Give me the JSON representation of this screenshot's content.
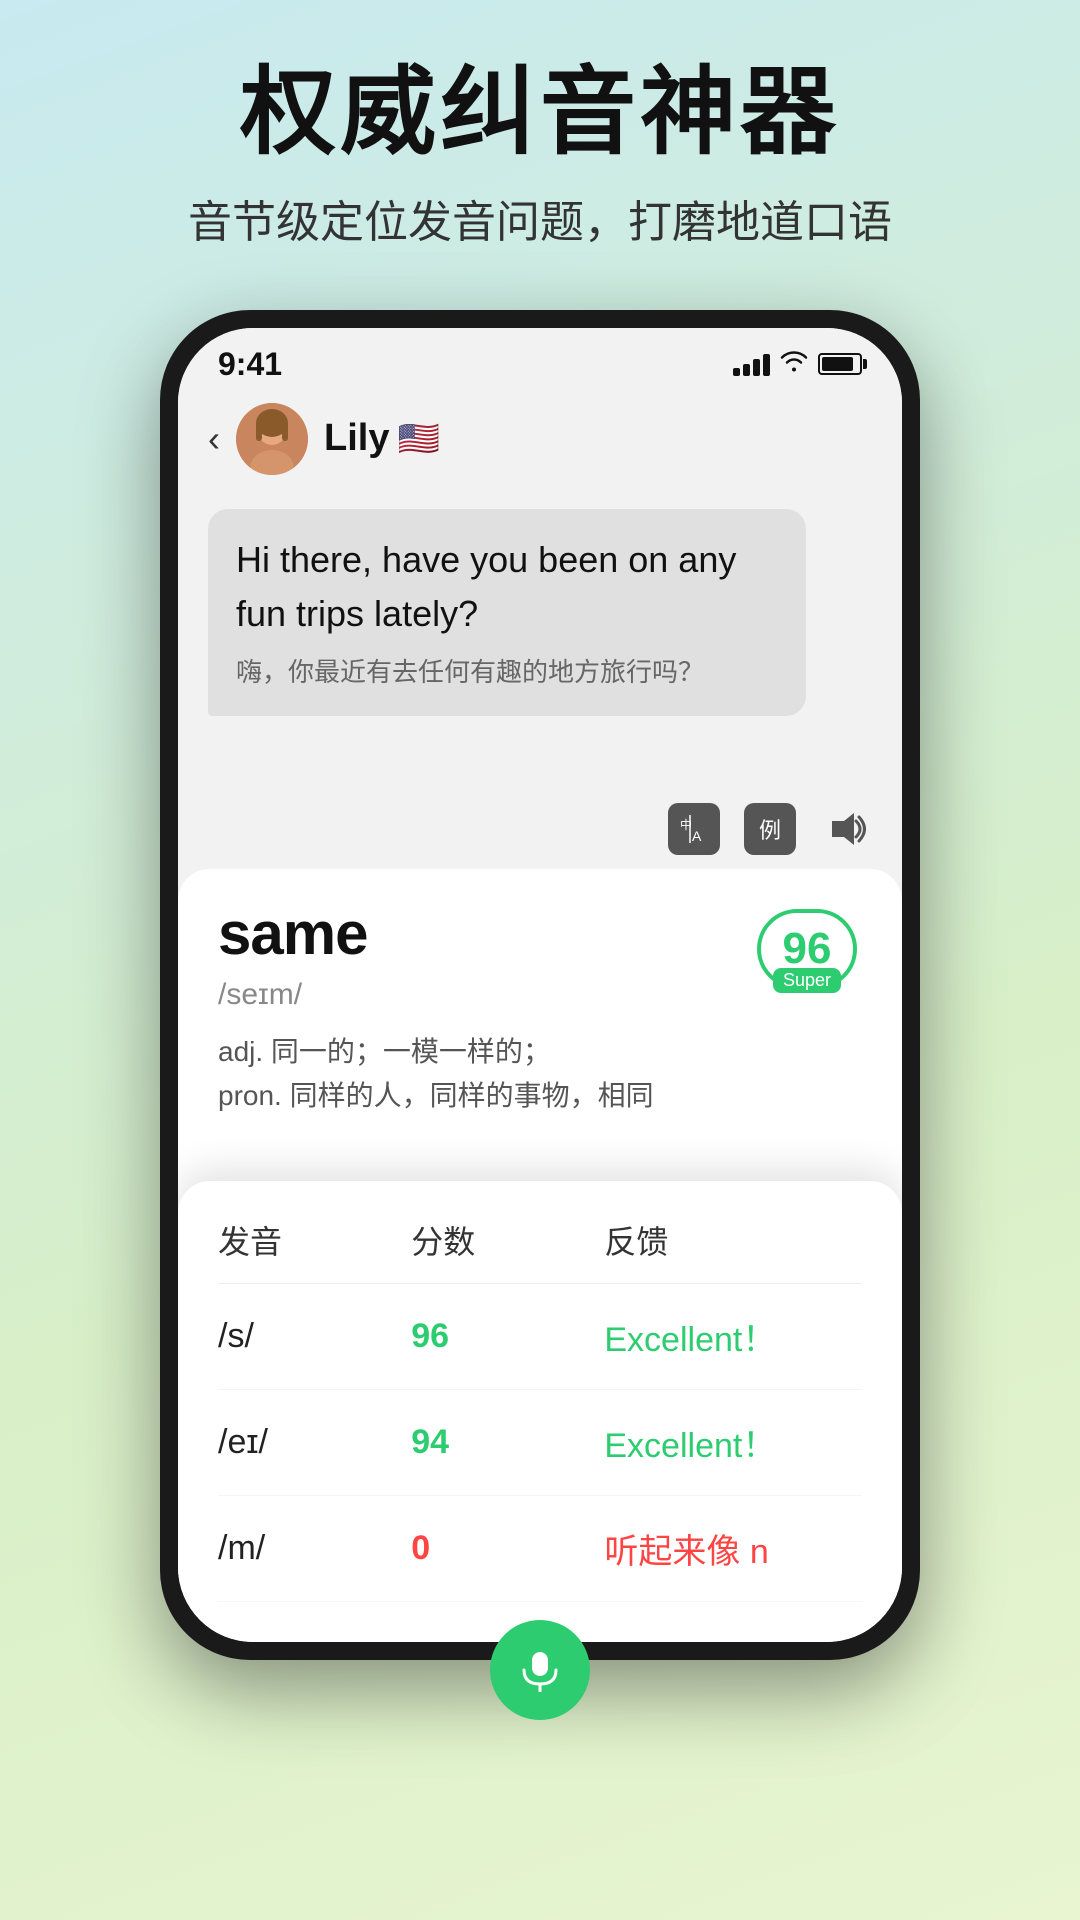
{
  "page": {
    "background": "linear-gradient(160deg, #c8eaf0 0%, #d8efc8 60%, #e8f5d0 100%)"
  },
  "header": {
    "main_title": "权威纠音神器",
    "sub_title": "音节级定位发音问题，打磨地道口语"
  },
  "phone": {
    "status_bar": {
      "time": "9:41"
    },
    "nav": {
      "back_label": "‹",
      "name": "Lily",
      "flag": "🇺🇸"
    },
    "chat": {
      "english_text": "Hi there, have you been on any fun trips lately?",
      "chinese_text": "嗨，你最近有去任何有趣的地方旅行吗？"
    },
    "action_buttons": {
      "translate": "中A",
      "example": "例",
      "sound": "🔊"
    },
    "word_card": {
      "word": "same",
      "phonetic": "/seɪm/",
      "score": "96",
      "score_label": "Super",
      "definition_1": "adj. 同一的；一模一样的；",
      "definition_2": "pron. 同样的人，同样的事物，相同"
    },
    "pron_table": {
      "headers": {
        "sound": "发音",
        "score": "分数",
        "feedback": "反馈"
      },
      "rows": [
        {
          "sound": "/s/",
          "score": "96",
          "score_color": "green",
          "feedback": "Excellent！",
          "feedback_color": "green"
        },
        {
          "sound": "/eɪ/",
          "score": "94",
          "score_color": "green",
          "feedback": "Excellent！",
          "feedback_color": "green"
        },
        {
          "sound": "/m/",
          "score": "0",
          "score_color": "red",
          "feedback": "听起来像 n",
          "feedback_color": "red"
        }
      ]
    }
  }
}
